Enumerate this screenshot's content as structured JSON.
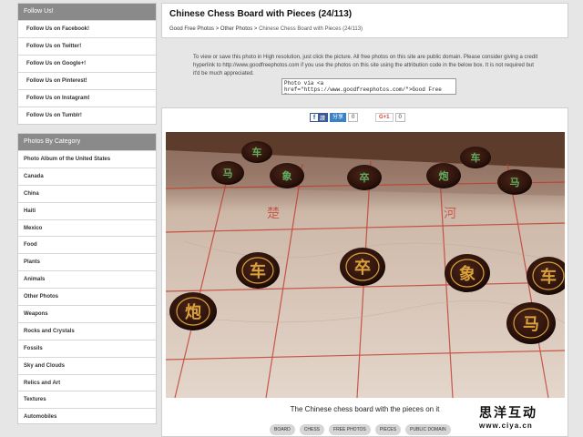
{
  "follow": {
    "heading": "Follow Us!",
    "items": [
      "Follow Us on Facebook!",
      "Follow Us on Twitter!",
      "Follow Us on Google+!",
      "Follow Us on Pinterest!",
      "Follow Us on Instagram!",
      "Follow Us on Tumblr!"
    ]
  },
  "categories": {
    "heading": "Photos By Category",
    "items": [
      "Photo Album of the United States",
      "Canada",
      "China",
      "Haiti",
      "Mexico",
      "Food",
      "Plants",
      "Animals",
      "Other Photos",
      "Weapons",
      "Rocks and Crystals",
      "Fossils",
      "Sky and Clouds",
      "Relics and Art",
      "Textures",
      "Automobiles"
    ]
  },
  "page": {
    "title": "Chinese Chess Board with Pieces (24/113)",
    "breadcrumb": {
      "home": "Good Free Photos",
      "sep": " > ",
      "section": "Other Photos",
      "current": "Chinese Chess Board with Pieces (24/113)"
    },
    "info_text": "To view or save this photo in High resolution, just click the picture. All free photos on this site are public domain. Please consider giving a credit hyperlink to http://www.goodfreephotos.com if you use the photos on this site using the attribution code in the below box. It is not required but it'd be much appreciated.",
    "attribution_code": "Photo via <a href=\"https://www.goodfreephotos.com/\">Good Free Photos</a>"
  },
  "share": {
    "fb_label": "讚",
    "fb_share_label": "分享",
    "fb_count": "0",
    "gplus_label": "G+1",
    "gplus_count": "0"
  },
  "photo": {
    "caption": "The Chinese chess board with the pieces on it",
    "piece_characters": [
      "车",
      "马",
      "象",
      "卒",
      "炮"
    ]
  },
  "tags": [
    "BOARD",
    "CHESS",
    "FREE PHOTOS",
    "PIECES",
    "PUBLIC DOMAIN"
  ],
  "watermark": {
    "chinese": "思洋互动",
    "url": "www.ciya.cn"
  },
  "colors": {
    "panel_header": "#8a8a8a",
    "facebook": "#3b5998",
    "board": "#d8c6b6",
    "board_lines": "#c0392b",
    "piece": "#3b1d14",
    "piece_glyph": "#d9a13a"
  }
}
